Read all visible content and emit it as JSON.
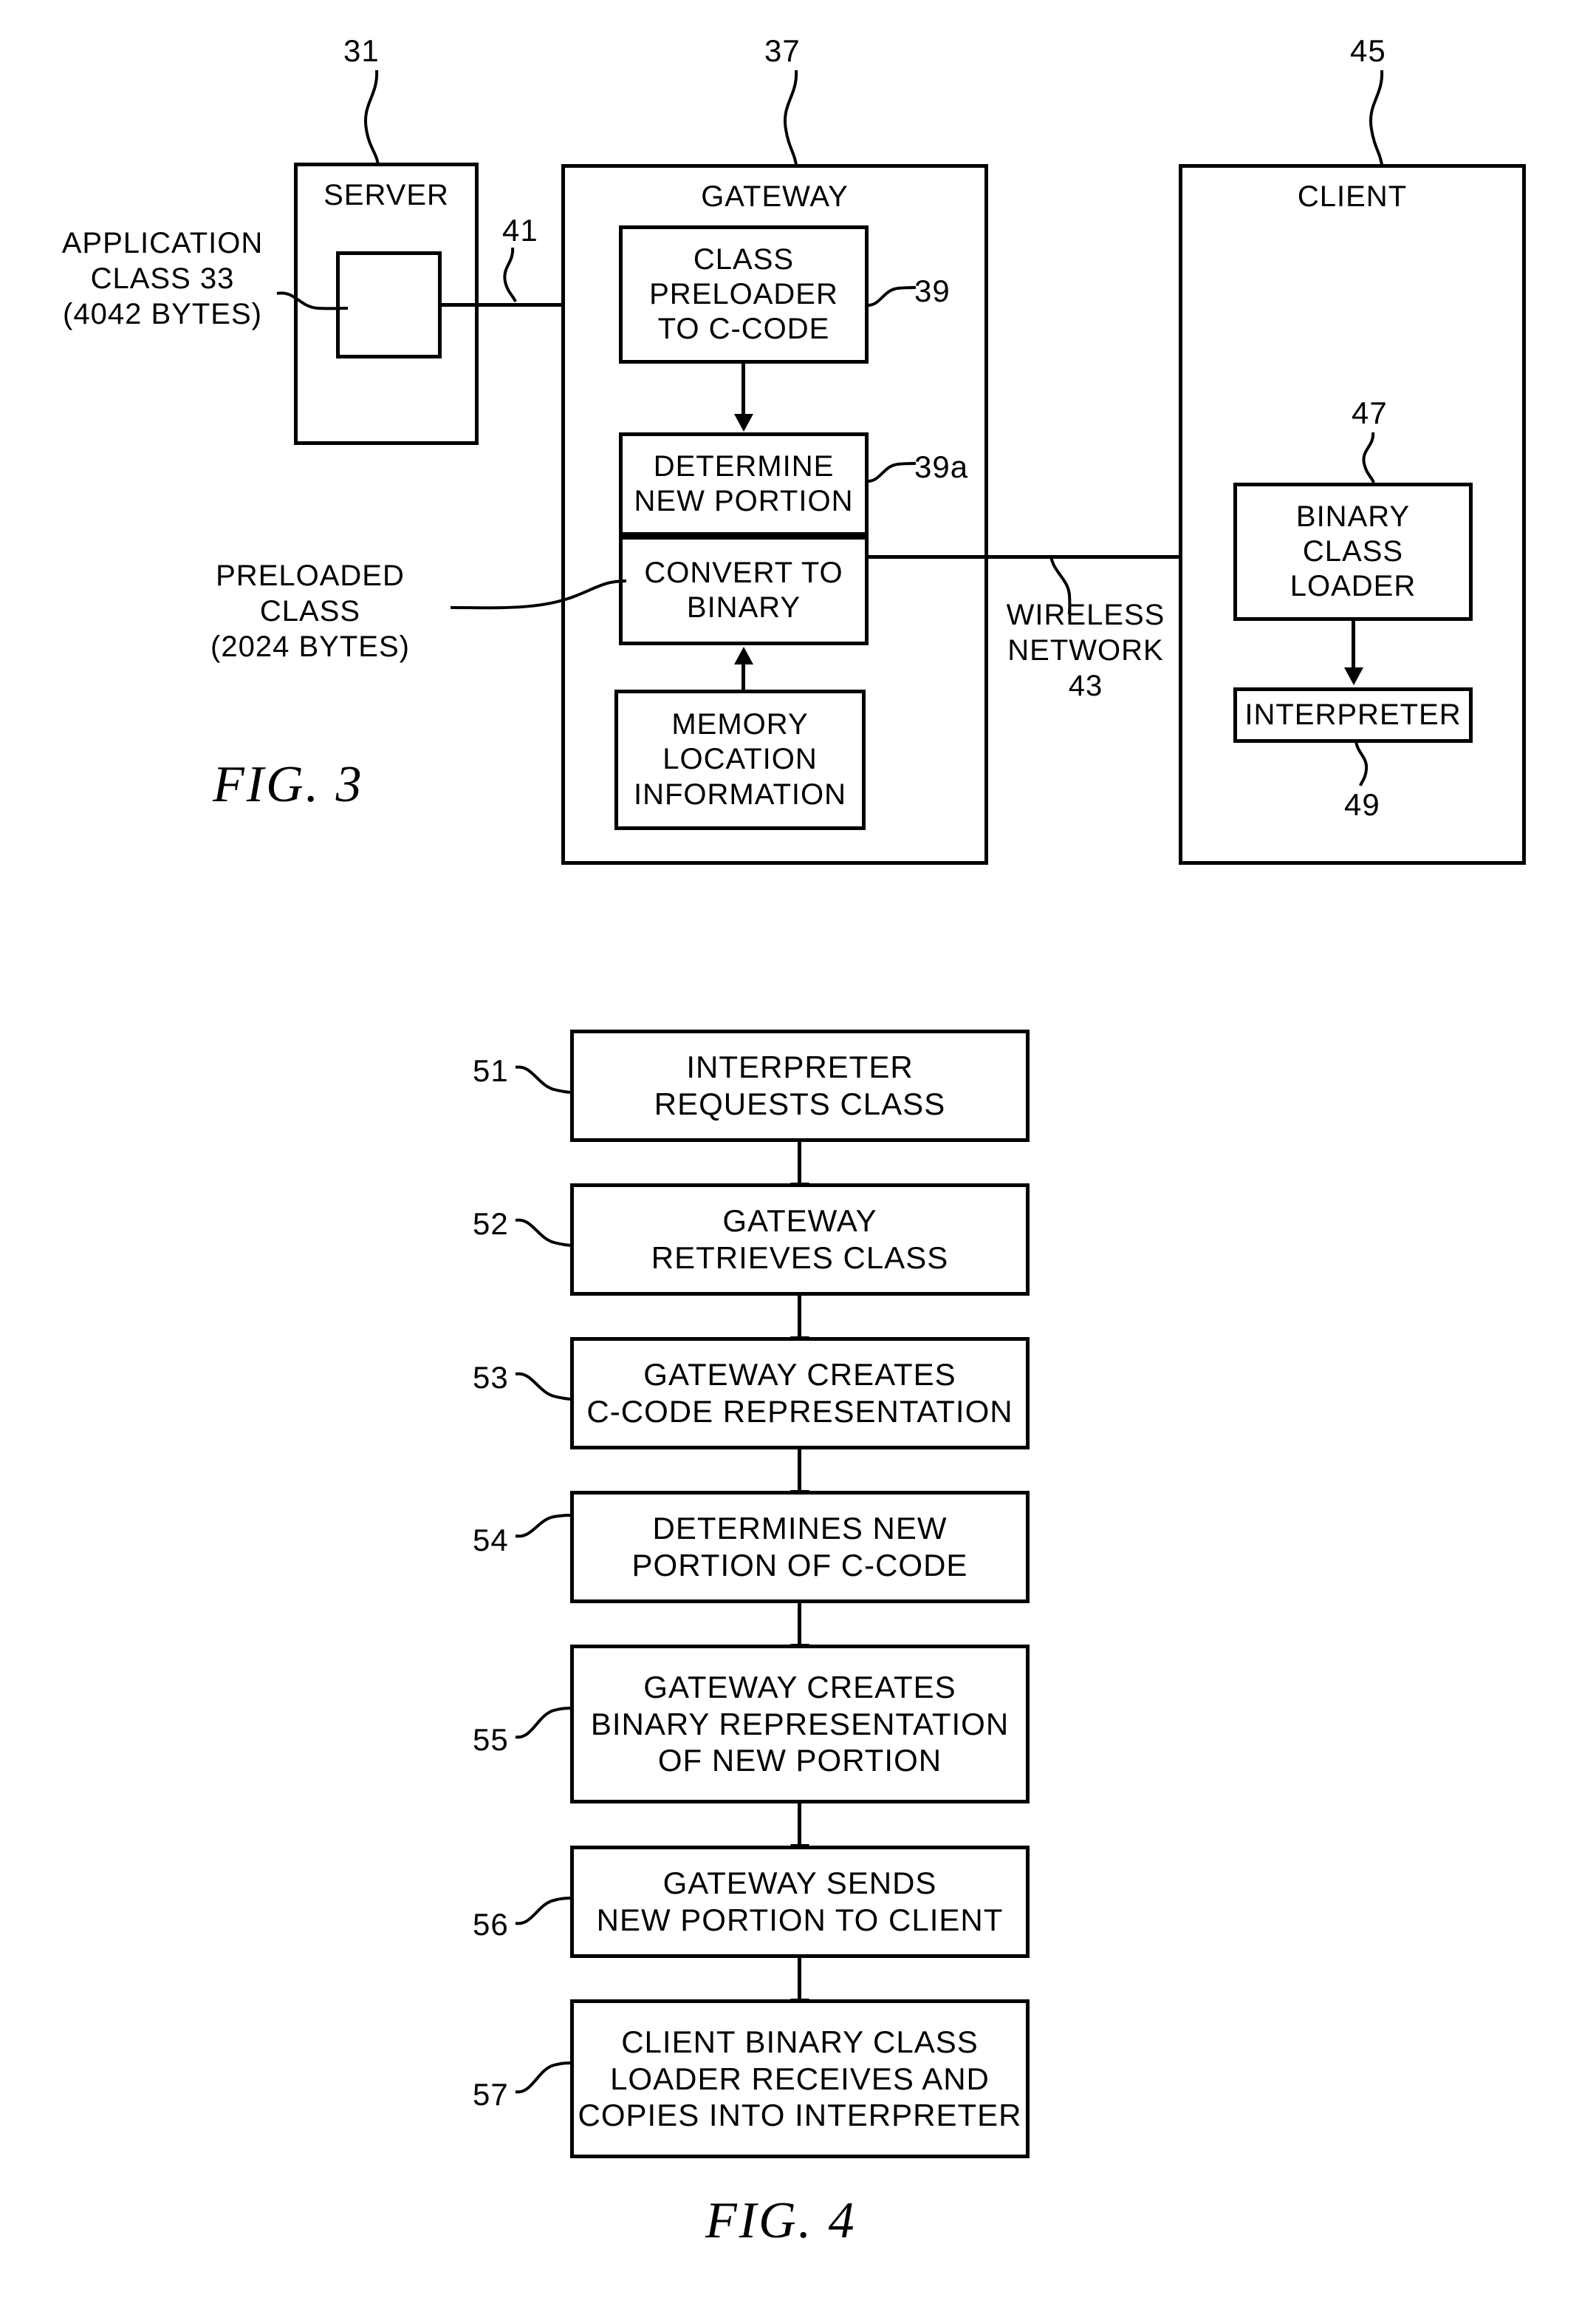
{
  "figures": [
    {
      "id": "fig3",
      "caption": "FIG.  3",
      "nodes": {
        "server": {
          "title": "SERVER",
          "ref": "31"
        },
        "server_inner": {
          "label": ""
        },
        "application_class": {
          "text": "APPLICATION\nCLASS 33\n(4042 BYTES)"
        },
        "link_41": {
          "ref": "41"
        },
        "gateway": {
          "title": "GATEWAY",
          "ref": "37"
        },
        "class_preloader": {
          "text": "CLASS\nPRELOADER\nTO C-CODE",
          "ref": "39"
        },
        "determine_new_portion": {
          "text": "DETERMINE\nNEW PORTION",
          "ref": "39a"
        },
        "convert_to_binary": {
          "text": "CONVERT TO\nBINARY"
        },
        "preloaded_class": {
          "text": "PRELOADED\nCLASS\n(2024 BYTES)"
        },
        "memory_location_information": {
          "text": "MEMORY\nLOCATION\nINFORMATION"
        },
        "wireless_network": {
          "text": "WIRELESS\nNETWORK\n43"
        },
        "client": {
          "title": "CLIENT",
          "ref": "45"
        },
        "binary_class_loader": {
          "text": "BINARY\nCLASS\nLOADER",
          "ref": "47"
        },
        "interpreter": {
          "text": "INTERPRETER",
          "ref": "49"
        }
      }
    },
    {
      "id": "fig4",
      "caption": "FIG.  4",
      "steps": [
        {
          "ref": "51",
          "text": "INTERPRETER\nREQUESTS CLASS"
        },
        {
          "ref": "52",
          "text": "GATEWAY\nRETRIEVES CLASS"
        },
        {
          "ref": "53",
          "text": "GATEWAY CREATES\nC-CODE REPRESENTATION"
        },
        {
          "ref": "54",
          "text": "DETERMINES NEW\nPORTION OF C-CODE"
        },
        {
          "ref": "55",
          "text": "GATEWAY CREATES\nBINARY REPRESENTATION\nOF NEW PORTION"
        },
        {
          "ref": "56",
          "text": "GATEWAY SENDS\nNEW PORTION TO CLIENT"
        },
        {
          "ref": "57",
          "text": "CLIENT BINARY CLASS\nLOADER RECEIVES AND\nCOPIES INTO INTERPRETER"
        }
      ]
    }
  ],
  "colors": {
    "ink": "#000000",
    "paper": "#ffffff"
  }
}
